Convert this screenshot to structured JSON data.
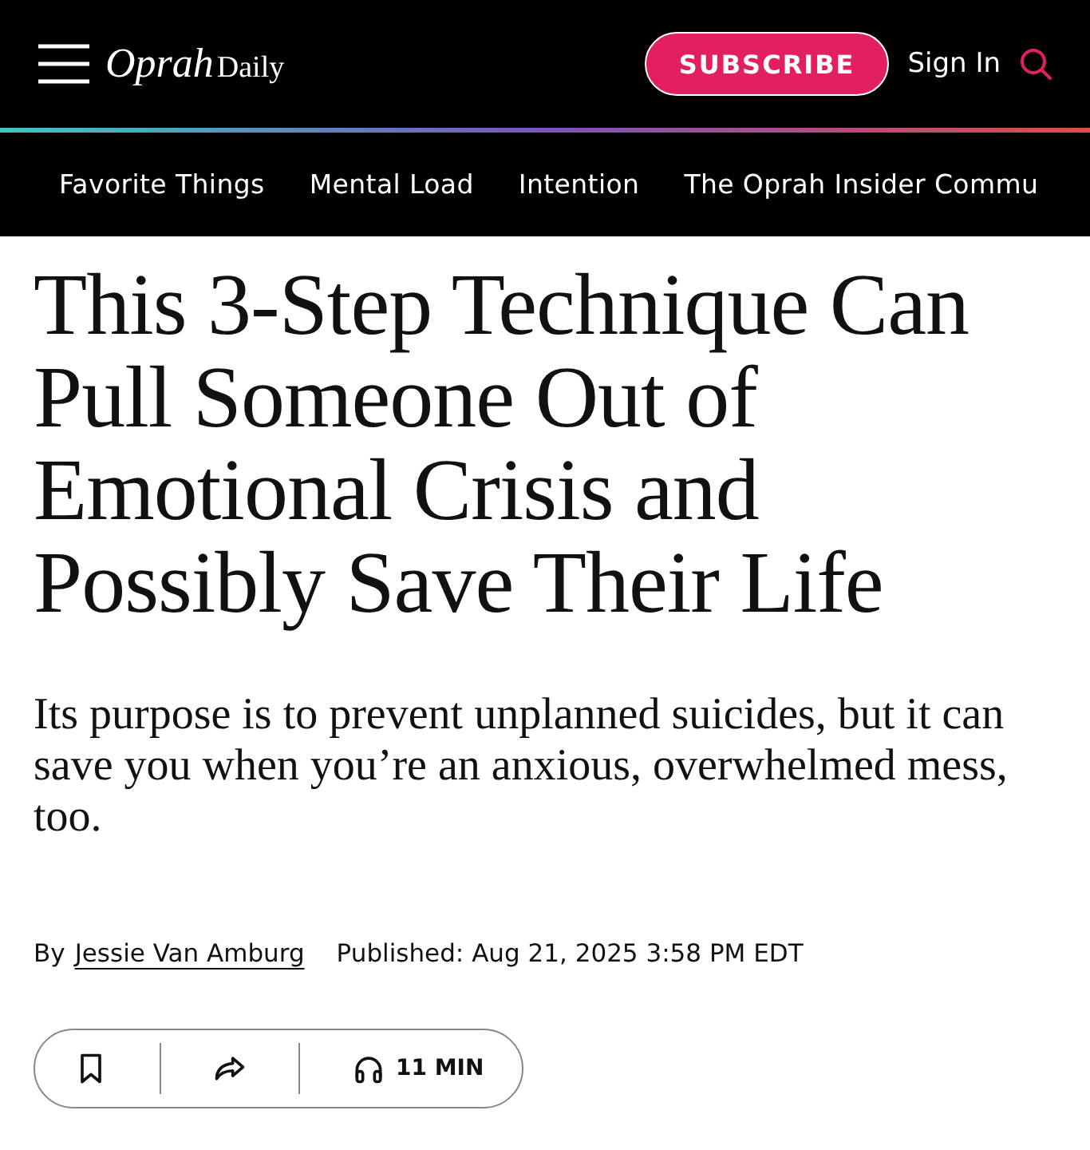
{
  "header": {
    "logo": {
      "script": "Oprah",
      "word": "Daily"
    },
    "subscribe": "SUBSCRIBE",
    "sign_in": "Sign In"
  },
  "nav": [
    "Favorite Things",
    "Mental Load",
    "Intention",
    "The Oprah Insider Commu"
  ],
  "article": {
    "headline": "This 3-Step Technique Can Pull Someone Out of Emotional Crisis and Possibly Save Their Life",
    "dek": "Its purpose is to prevent unplanned suicides, but it can save you when you’re an anxious, overwhelmed mess, too.",
    "byline_prefix": "By",
    "author": "Jessie Van Amburg",
    "published": "Published: Aug 21, 2025 3:58 PM EDT",
    "listen": "11 MIN"
  }
}
